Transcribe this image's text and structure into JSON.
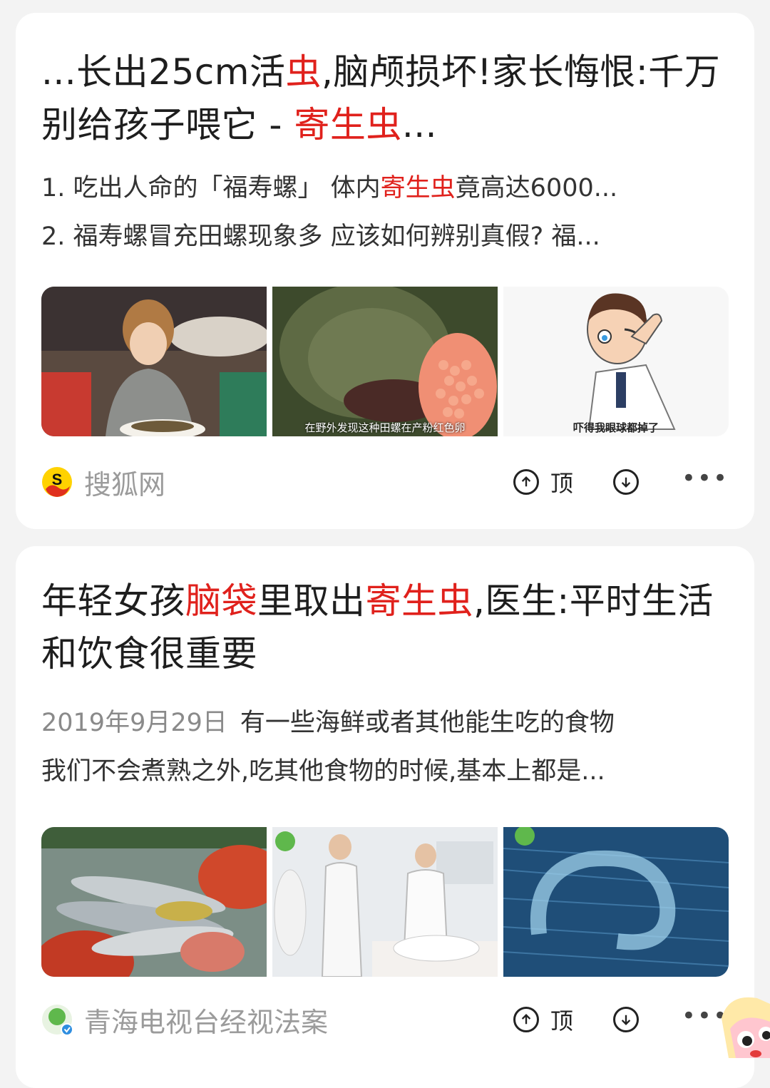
{
  "results": [
    {
      "title_parts": [
        {
          "text": "...长出25cm活",
          "hl": false
        },
        {
          "text": "虫",
          "hl": true
        },
        {
          "text": ",脑颅损坏!家长悔恨:千万别给孩子喂它 - ",
          "hl": false
        },
        {
          "text": "寄生虫",
          "hl": true
        },
        {
          "text": "...",
          "hl": false
        }
      ],
      "snippet_lines": [
        [
          {
            "text": "1. 吃出人命的「福寿螺」 体内",
            "hl": false
          },
          {
            "text": "寄生虫",
            "hl": true
          },
          {
            "text": "竟高达6000...",
            "hl": false
          }
        ],
        [
          {
            "text": "2. 福寿螺冒充田螺现象多 应该如何辨别真假? 福...",
            "hl": false
          }
        ]
      ],
      "thumbnails": [
        {
          "caption": ""
        },
        {
          "caption": "在野外发现这种田螺在产粉红色卵"
        },
        {
          "caption": "吓得我眼球都掉了"
        }
      ],
      "source": "搜狐网",
      "upvote_label": "顶"
    },
    {
      "title_parts": [
        {
          "text": "年轻女孩",
          "hl": false
        },
        {
          "text": "脑袋",
          "hl": true
        },
        {
          "text": "里取出",
          "hl": false
        },
        {
          "text": "寄生虫",
          "hl": true
        },
        {
          "text": ",医生:平时生活和饮食很重要",
          "hl": false
        }
      ],
      "date": "2019年9月29日",
      "snippet_lines": [
        [
          {
            "text": "有一些海鲜或者其他能生吃的食物",
            "hl": false
          }
        ],
        [
          {
            "text": "我们不会煮熟之外,吃其他食物的时候,基本上都是...",
            "hl": false
          }
        ]
      ],
      "thumbnails": [
        {
          "caption": ""
        },
        {
          "caption": ""
        },
        {
          "caption": ""
        }
      ],
      "source": "青海电视台经视法案",
      "upvote_label": "顶"
    }
  ],
  "colors": {
    "highlight": "#e0211c",
    "source_text": "#9b9b9b",
    "background": "#f3f3f3"
  }
}
